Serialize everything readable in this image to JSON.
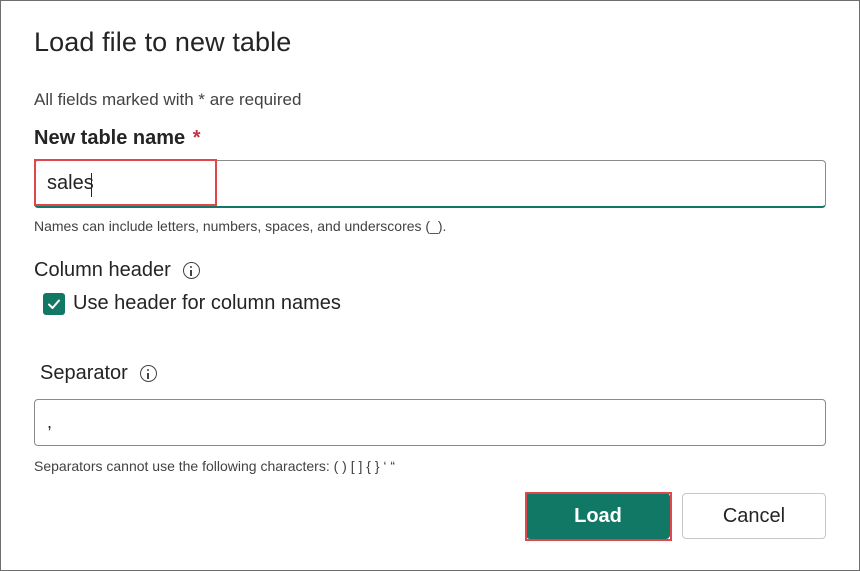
{
  "dialog": {
    "title": "Load file to new table",
    "required_note": "All fields marked with * are required"
  },
  "table_name": {
    "label": "New table name",
    "required_mark": "*",
    "value": "sales",
    "hint": "Names can include letters, numbers, spaces, and underscores (_)."
  },
  "column_header": {
    "label": "Column header",
    "checkbox_label": "Use header for column names",
    "checked": true
  },
  "separator": {
    "label": "Separator",
    "value": ",",
    "hint": "Separators cannot use the following characters: ( ) [ ] { } ‘ “"
  },
  "actions": {
    "load_label": "Load",
    "cancel_label": "Cancel"
  },
  "colors": {
    "accent": "#117865",
    "highlight": "#e0474c",
    "required": "#c4314b"
  },
  "icons": {
    "info": "info-icon",
    "checkmark": "checkmark-icon"
  }
}
